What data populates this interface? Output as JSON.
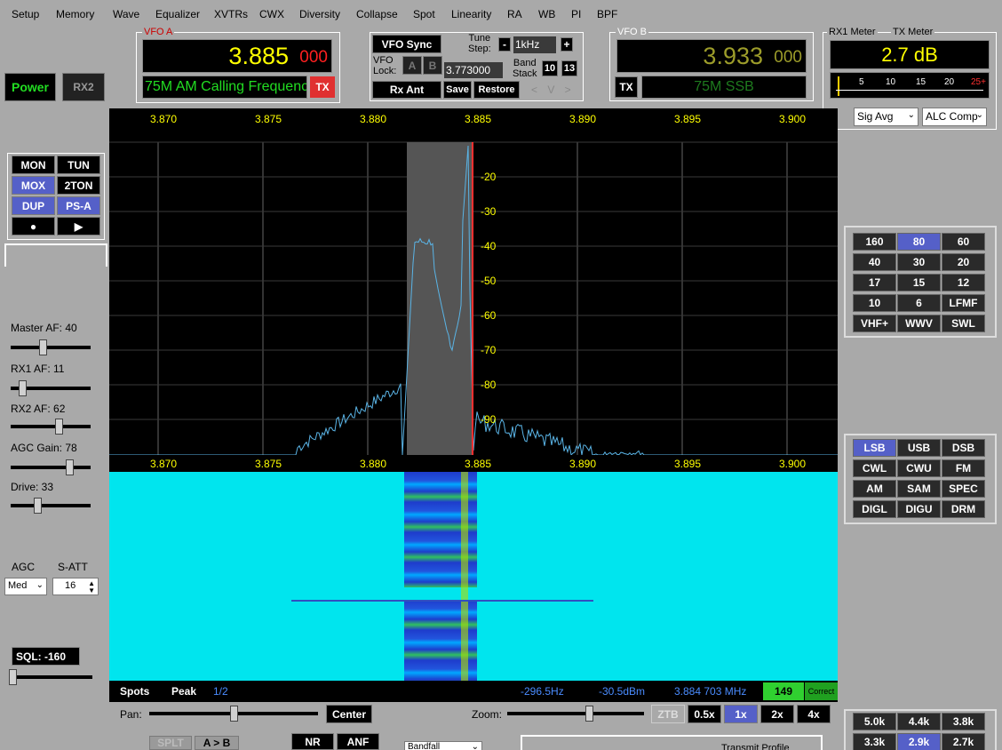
{
  "menu": [
    "Setup",
    "Memory",
    "Wave",
    "Equalizer",
    "XVTRs",
    "CWX",
    "Diversity",
    "Collapse",
    "Spot",
    "Linearity",
    "RA",
    "WB",
    "PI",
    "BPF"
  ],
  "power": {
    "power_label": "Power",
    "rx2_label": "RX2"
  },
  "vfo_a": {
    "title": "VFO A",
    "freq_main": "3.885",
    "freq_sub": "000",
    "name": "75M AM Calling Frequenc",
    "tx": "TX"
  },
  "vfo_b": {
    "title": "VFO B",
    "freq_main": "3.933",
    "freq_sub": "000",
    "name": "75M SSB",
    "tx": "TX"
  },
  "vfo_ctrl": {
    "sync": "VFO Sync",
    "lock_label": "VFO\nLock:",
    "lock_a": "A",
    "lock_b": "B",
    "lock_freq": "3.773000",
    "tune_step_label": "Tune\nStep:",
    "tune_step": "1kHz",
    "minus": "-",
    "plus": "+",
    "band_stack_label": "Band\nStack",
    "bs_10": "10",
    "bs_13": "13",
    "rx_ant": "Rx Ant",
    "save": "Save",
    "restore": "Restore",
    "nav": "< V >"
  },
  "meter": {
    "rx1_title": "RX1 Meter",
    "tx_title": "TX Meter",
    "value": "2.7 dB",
    "scale": [
      "5",
      "10",
      "15",
      "20",
      "25+"
    ],
    "mode1": "Sig Avg",
    "mode2": "ALC Comp"
  },
  "tx_buttons": [
    "MON",
    "TUN",
    "MOX",
    "2TON",
    "DUP",
    "PS-A",
    "●",
    "▶"
  ],
  "left": {
    "master_af_label": "Master AF:  40",
    "master_af": 40,
    "rx1_af_label": "RX1 AF:  11",
    "rx1_af": 11,
    "rx2_af_label": "RX2 AF:  62",
    "rx2_af": 62,
    "agc_gain_label": "AGC Gain:  78",
    "agc_gain": 78,
    "drive_label": "Drive:  33",
    "drive": 33,
    "agc_label": "AGC",
    "agc_value": "Med",
    "satt_label": "S-ATT",
    "satt_value": "16",
    "sql_label": "SQL: -160"
  },
  "panadapter": {
    "freq_labels": [
      "3.870",
      "3.875",
      "3.880",
      "3.885",
      "3.890",
      "3.895",
      "3.900"
    ],
    "db_labels": [
      "-20",
      "-30",
      "-40",
      "-50",
      "-60",
      "-70",
      "-80",
      "-90"
    ]
  },
  "status": {
    "spots": "Spots",
    "peak": "Peak",
    "page": "1/2",
    "offset": "-296.5Hz",
    "level": "-30.5dBm",
    "cursor_freq": "3.884 703 MHz",
    "count": "149",
    "correct": "Correct"
  },
  "bottom": {
    "pan_label": "Pan:",
    "center": "Center",
    "zoom_label": "Zoom:",
    "ztb": "ZTB",
    "z05": "0.5x",
    "z1": "1x",
    "z2": "2x",
    "z4": "4x",
    "splt": "SPLT",
    "atob": "A > B",
    "nr": "NR",
    "anf": "ANF",
    "bandfilter": "Bandfall",
    "transmit_profile": "Transmit Profile"
  },
  "bands": [
    "160",
    "80",
    "60",
    "40",
    "30",
    "20",
    "17",
    "15",
    "12",
    "10",
    "6",
    "LFMF",
    "VHF+",
    "WWV",
    "SWL"
  ],
  "modes": [
    "LSB",
    "USB",
    "DSB",
    "CWL",
    "CWU",
    "FM",
    "AM",
    "SAM",
    "SPEC",
    "DIGL",
    "DIGU",
    "DRM"
  ],
  "filters": [
    "5.0k",
    "4.4k",
    "3.8k",
    "3.3k",
    "2.9k",
    "2.7k"
  ],
  "colors": {
    "background": "#a9a9a9",
    "waterfall_bg": "#00e5ee",
    "trace": "#5ab4e6",
    "passband": "#555555",
    "vfo_line": "#ff3030",
    "freq_label": "#ffff00",
    "selected": "#5560c8"
  }
}
